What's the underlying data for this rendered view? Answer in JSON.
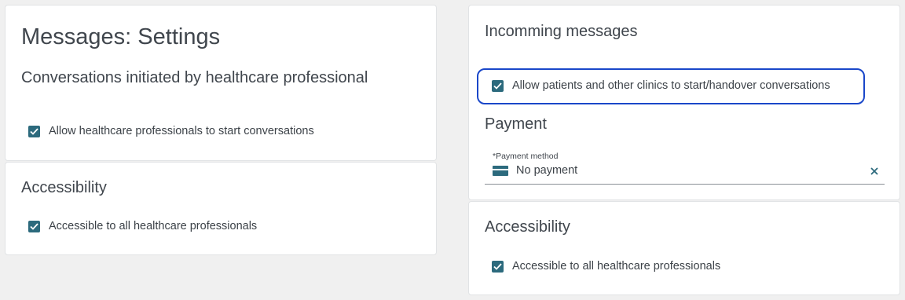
{
  "left_panel": {
    "title": "Messages: Settings",
    "section_initiated": {
      "heading": "Conversations initiated by healthcare professional",
      "checkbox_label": "Allow healthcare professionals to start conversations",
      "checked": true
    },
    "section_accessibility": {
      "heading": "Accessibility",
      "checkbox_label": "Accessible to all healthcare professionals",
      "checked": true
    }
  },
  "right_panel": {
    "incoming": {
      "heading": "Incomming messages",
      "checkbox_label": "Allow patients and other clinics to start/handover conversations",
      "checked": true
    },
    "payment": {
      "heading": "Payment",
      "field_label": "*Payment method",
      "field_value": "No payment"
    },
    "accessibility": {
      "heading": "Accessibility",
      "checkbox_label": "Accessible to all healthcare professionals",
      "checked": true
    }
  },
  "colors": {
    "checkbox": "#2c6a7d",
    "highlight": "#1a47c9",
    "background": "#f0f0f0"
  }
}
